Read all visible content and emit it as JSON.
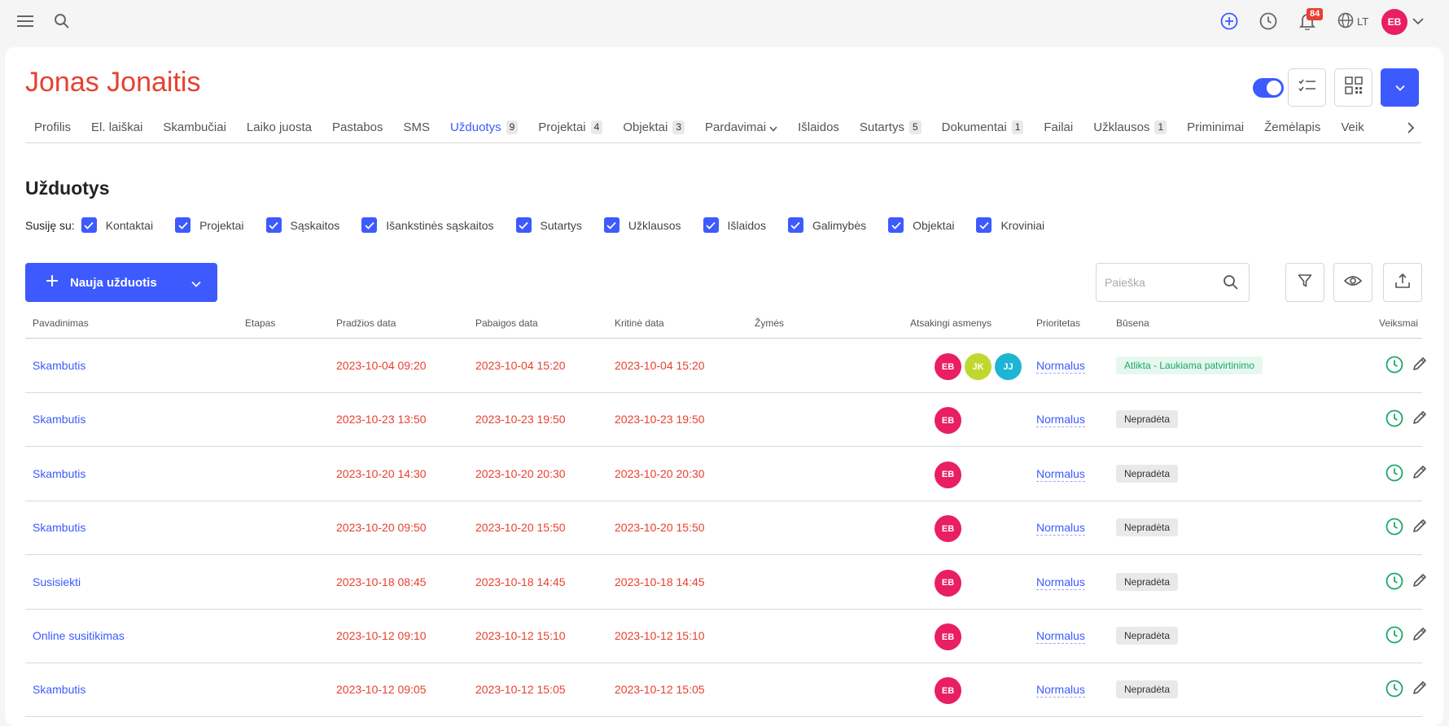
{
  "topbar": {
    "menu_icon": "menu-icon",
    "search_icon": "search-icon",
    "add_icon": "plus-circle-icon",
    "clock_icon": "clock-icon",
    "bell_icon": "bell-icon",
    "notifications_count": "84",
    "language": "LT",
    "user_initials": "EB"
  },
  "contact": {
    "name": "Jonas Jonaitis"
  },
  "tabs": [
    {
      "label": "Profilis",
      "count": ""
    },
    {
      "label": "El. laiškai",
      "count": ""
    },
    {
      "label": "Skambučiai",
      "count": ""
    },
    {
      "label": "Laiko juosta",
      "count": ""
    },
    {
      "label": "Pastabos",
      "count": ""
    },
    {
      "label": "SMS",
      "count": ""
    },
    {
      "label": "Užduotys",
      "count": "9"
    },
    {
      "label": "Projektai",
      "count": "4"
    },
    {
      "label": "Objektai",
      "count": "3"
    },
    {
      "label": "Pardavimai",
      "count": ""
    },
    {
      "label": "Išlaidos",
      "count": ""
    },
    {
      "label": "Sutartys",
      "count": "5"
    },
    {
      "label": "Dokumentai",
      "count": "1"
    },
    {
      "label": "Failai",
      "count": ""
    },
    {
      "label": "Užklausos",
      "count": "1"
    },
    {
      "label": "Priminimai",
      "count": ""
    },
    {
      "label": "Žemėlapis",
      "count": ""
    },
    {
      "label": "Veik",
      "count": ""
    }
  ],
  "section": {
    "title": "Užduotys",
    "related_label": "Susiję su:",
    "filters": [
      "Kontaktai",
      "Projektai",
      "Sąskaitos",
      "Išankstinės sąskaitos",
      "Sutartys",
      "Užklausos",
      "Išlaidos",
      "Galimybės",
      "Objektai",
      "Kroviniai"
    ]
  },
  "toolbar": {
    "new_task_label": "Nauja užduotis",
    "search_placeholder": "Paieška"
  },
  "table": {
    "headers": [
      "Pavadinimas",
      "Etapas",
      "Pradžios data",
      "Pabaigos data",
      "Kritinė data",
      "Žymės",
      "Atsakingi asmenys",
      "Prioritetas",
      "Būsena",
      "Veiksmai"
    ],
    "rows": [
      {
        "title": "Skambutis",
        "start": "2023-10-04 09:20",
        "end": "2023-10-04 15:20",
        "critical": "2023-10-04 15:20",
        "people": [
          "EB",
          "JK",
          "JJ"
        ],
        "priority": "Normalus",
        "status": "Atlikta - Laukiama patvirtinimo",
        "status_type": "done"
      },
      {
        "title": "Skambutis",
        "start": "2023-10-23 13:50",
        "end": "2023-10-23 19:50",
        "critical": "2023-10-23 19:50",
        "people": [
          "EB"
        ],
        "priority": "Normalus",
        "status": "Nepradėta",
        "status_type": "todo"
      },
      {
        "title": "Skambutis",
        "start": "2023-10-20 14:30",
        "end": "2023-10-20 20:30",
        "critical": "2023-10-20 20:30",
        "people": [
          "EB"
        ],
        "priority": "Normalus",
        "status": "Nepradėta",
        "status_type": "todo"
      },
      {
        "title": "Skambutis",
        "start": "2023-10-20 09:50",
        "end": "2023-10-20 15:50",
        "critical": "2023-10-20 15:50",
        "people": [
          "EB"
        ],
        "priority": "Normalus",
        "status": "Nepradėta",
        "status_type": "todo"
      },
      {
        "title": "Susisiekti",
        "start": "2023-10-18 08:45",
        "end": "2023-10-18 14:45",
        "critical": "2023-10-18 14:45",
        "people": [
          "EB"
        ],
        "priority": "Normalus",
        "status": "Nepradėta",
        "status_type": "todo"
      },
      {
        "title": "Online susitikimas",
        "start": "2023-10-12 09:10",
        "end": "2023-10-12 15:10",
        "critical": "2023-10-12 15:10",
        "people": [
          "EB"
        ],
        "priority": "Normalus",
        "status": "Nepradėta",
        "status_type": "todo"
      },
      {
        "title": "Skambutis",
        "start": "2023-10-12 09:05",
        "end": "2023-10-12 15:05",
        "critical": "2023-10-12 15:05",
        "people": [
          "EB"
        ],
        "priority": "Normalus",
        "status": "Nepradėta",
        "status_type": "todo"
      }
    ]
  },
  "colors": {
    "accent": "#3d5afe",
    "danger": "#e8402f",
    "success": "#1aa76a",
    "avatar_EB": "#e91e63",
    "avatar_JK": "#c0d730",
    "avatar_JJ": "#1cb5d4"
  }
}
